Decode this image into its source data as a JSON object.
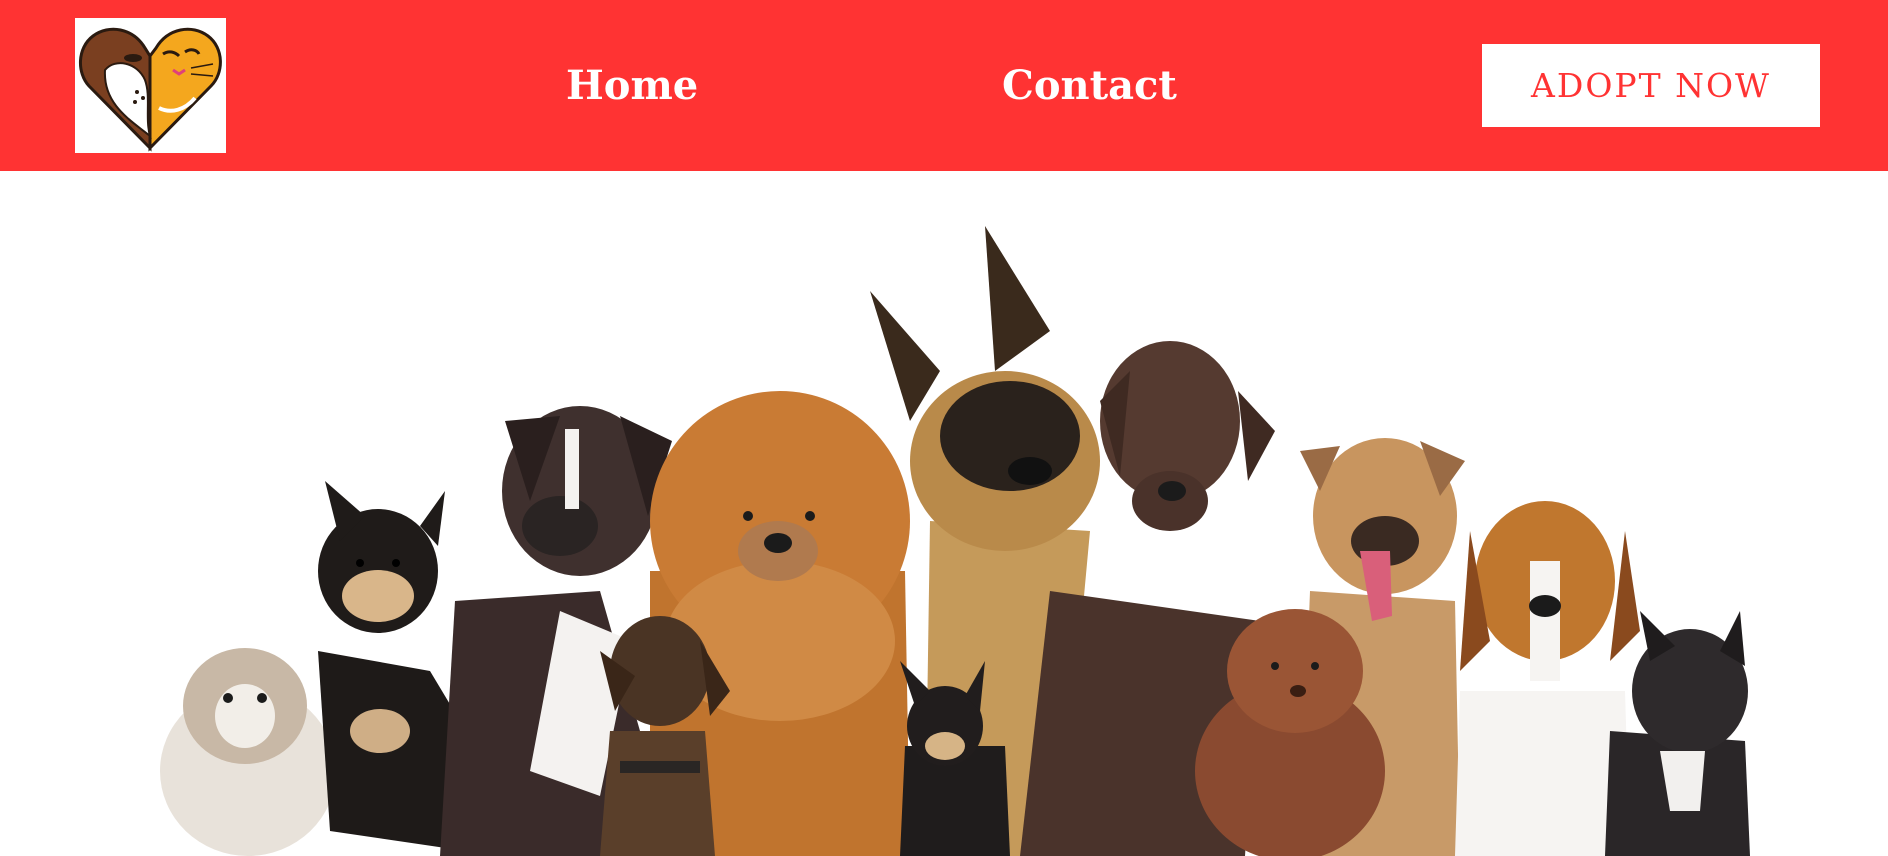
{
  "header": {
    "logo_icon": "dog-cat-heart-logo-icon",
    "nav": [
      {
        "label": "Home"
      },
      {
        "label": "Contact"
      }
    ],
    "cta_label": "ADOPT NOW"
  },
  "hero": {
    "image_icon": "group-of-dogs-photo"
  },
  "colors": {
    "brand_red": "#ff3333",
    "white": "#ffffff"
  }
}
